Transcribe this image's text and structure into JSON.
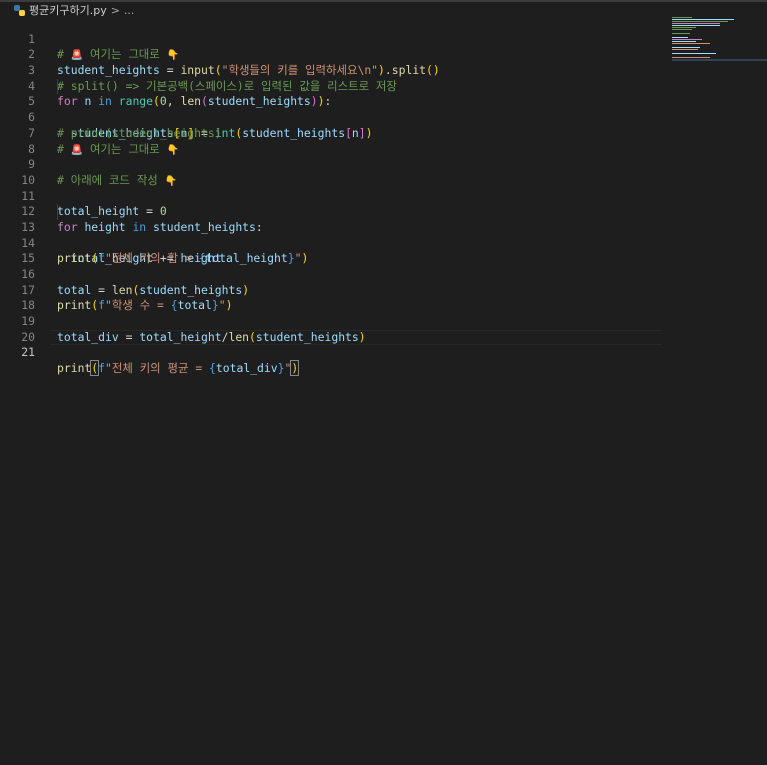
{
  "breadcrumb": {
    "file_icon": "python-file-icon",
    "file_name": "평균키구하기.py",
    "separator": ">",
    "more": "..."
  },
  "editor": {
    "current_line": 21,
    "line_numbers": [
      "1",
      "2",
      "3",
      "4",
      "5",
      "6",
      "7",
      "8",
      "9",
      "10",
      "11",
      "12",
      "13",
      "14",
      "15",
      "16",
      "17",
      "18",
      "19",
      "20",
      "21"
    ],
    "code": {
      "l1_comment": "# ",
      "l1_text": " 여기는 그대로 ",
      "siren_emoji": "🚨",
      "hand_emoji": "👇",
      "l2_var": "student_heights",
      "l2_eq": " = ",
      "l2_fn": "input",
      "l2_str": "\"학생들의 키를 입력하세요\\n\"",
      "l2_method": "split",
      "l3_comment": "# split() => 기본공백(스페이스)로 입력된 값을 리스트로 저장",
      "l4_for": "for",
      "l4_n": "n",
      "l4_in": "in",
      "l4_range": "range",
      "l4_zero": "0",
      "l4_len": "len",
      "l4_arg": "student_heights",
      "l5_var": "student_heights",
      "l5_n": "n",
      "l5_int": "int",
      "l5_arg": "student_heights",
      "l5_n2": "n",
      "l6_comment": "# print(student_heights)",
      "l7_comment": "# ",
      "l7_text": " 여기는 그대로 ",
      "l9_comment": "# 아래에 코드 작성 ",
      "l11_var": "total_height",
      "l11_eq": " = ",
      "l11_zero": "0",
      "l12_for": "for",
      "l12_height": "height",
      "l12_in": "in",
      "l12_list": "student_heights",
      "l13_var": "total_height",
      "l13_op": " += ",
      "l13_height": "height",
      "l14_print": "print",
      "l14_f": "f",
      "l14_str": "\"전체 키의 합 = ",
      "l14_expr": "total_height",
      "l15_print": "print",
      "l16_var": "total",
      "l16_len": "len",
      "l16_arg": "student_heights",
      "l17_print": "print",
      "l17_f": "f",
      "l17_str": "\"학생 수 = ",
      "l17_expr": "total",
      "l19_var": "total_div",
      "l19_a": "total_height",
      "l19_len": "len",
      "l19_arg": "student_heights",
      "l21_print": "print",
      "l21_f": "f",
      "l21_str": "\"전체 키의 평균 = ",
      "l21_expr": "total_div",
      "quote": "\"",
      "lbrace": "{",
      "rbrace": "}"
    }
  },
  "colors": {
    "background": "#1e1e1e",
    "comment": "#6a9955",
    "keyword": "#c586c0",
    "variable": "#9cdcfe",
    "function": "#dcdcaa",
    "string": "#ce9178",
    "number": "#b5cea8"
  }
}
